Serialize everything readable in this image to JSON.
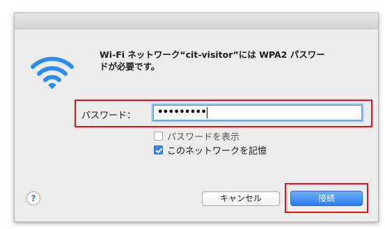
{
  "dialog": {
    "message_line1": "Wi-Fi ネットワーク“cit-visitor”には WPA2 パスワー",
    "message_line2": "ドが必要です。",
    "icon": "wifi-icon"
  },
  "password": {
    "label": "パスワード：",
    "masked_value": "•••••••••"
  },
  "options": {
    "show_password_label": "パスワードを表示",
    "show_password_checked": false,
    "remember_network_label": "このネットワークを記憶",
    "remember_network_checked": true
  },
  "buttons": {
    "help_label": "?",
    "cancel_label": "キャンセル",
    "connect_label": "接続"
  },
  "colors": {
    "accent": "#2a7cf0",
    "highlight_border": "#e0141b",
    "wifi": "#2d8cf2"
  }
}
